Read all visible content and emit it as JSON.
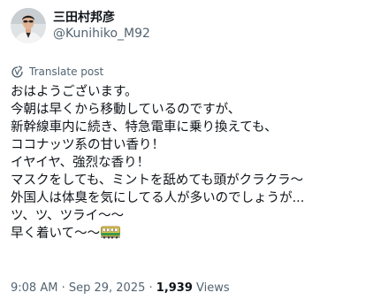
{
  "author": {
    "display_name": "三田村邦彦",
    "handle": "@Kunihiko_M92",
    "avatar_icon": "profile-photo"
  },
  "translate": {
    "label": "Translate post",
    "icon": "translate-icon"
  },
  "post": {
    "lines": [
      "おはようございます。",
      "今朝は早くから移動しているのですが、",
      "新幹線車内に続き、特急電車に乗り換えても、",
      "ココナッツ系の甘い香り！",
      "イヤイヤ、強烈な香り！",
      "マスクをしても、ミントを舐めても頭がクラクラ～",
      "外国人は体臭を気にしてる人が多いのでしょうが...",
      "ツ、ツ、ツライ～～",
      "早く着いて～～"
    ],
    "trailing_emoji": "train-emoji"
  },
  "meta": {
    "time": "9:08 AM",
    "separator1": " · ",
    "date": "Sep 29, 2025",
    "separator2": " · ",
    "views_count": "1,939",
    "views_label": " Views"
  },
  "colors": {
    "text_primary": "#0f1419",
    "text_secondary": "#536471"
  }
}
